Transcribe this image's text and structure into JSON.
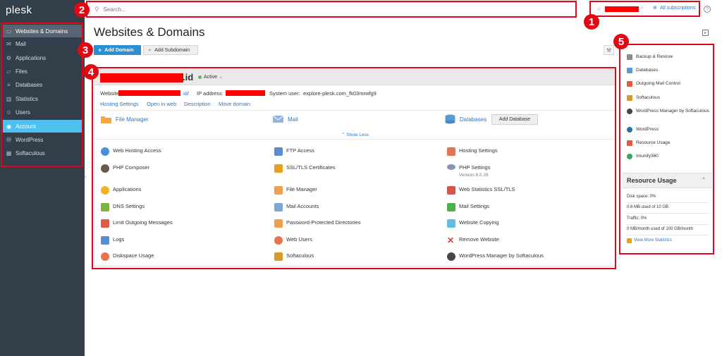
{
  "app": {
    "logo": "plesk"
  },
  "sidebar": {
    "items": [
      {
        "label": "Websites & Domains",
        "icon": "monitor-icon"
      },
      {
        "label": "Mail",
        "icon": "mail-icon"
      },
      {
        "label": "Applications",
        "icon": "gear-icon"
      },
      {
        "label": "Files",
        "icon": "folder-icon"
      },
      {
        "label": "Databases",
        "icon": "database-icon"
      },
      {
        "label": "Statistics",
        "icon": "bar-chart-icon"
      },
      {
        "label": "Users",
        "icon": "user-icon"
      },
      {
        "label": "Account",
        "icon": "account-icon"
      },
      {
        "label": "WordPress",
        "icon": "wordpress-icon"
      },
      {
        "label": "Softaculous",
        "icon": "softaculous-icon"
      }
    ],
    "active_index": 7,
    "highlight_index": 0
  },
  "topbar": {
    "search_placeholder": "Search...",
    "user_menu_caret": "⌄",
    "subscriptions_link": "All subscriptions"
  },
  "annotations": [
    "1",
    "2",
    "3",
    "4",
    "5"
  ],
  "page": {
    "title": "Websites & Domains",
    "add_domain": "Add Domain",
    "add_subdomain": "Add Subdomain"
  },
  "domain": {
    "name_suffix": ".id",
    "status": "Active",
    "website_label": "Website at",
    "website_suffix": ".id/",
    "ip_label": "IP address:",
    "system_user_label": "System user:",
    "system_user": "explore-plesk.com_fk03mrwfg9",
    "links": [
      "Hosting Settings",
      "Open in web",
      "Description",
      "Move domain"
    ],
    "quick": [
      {
        "label": "File Manager",
        "icon": "folder-icon"
      },
      {
        "label": "Mail",
        "icon": "mail-icon"
      },
      {
        "label": "Databases",
        "icon": "database-icon"
      }
    ],
    "add_database": "Add Database",
    "show_less": "⌃ Show Less",
    "tools": [
      {
        "label": "Web Hosting Access",
        "icon": "globe-icon",
        "color": "#4a90d9"
      },
      {
        "label": "FTP Access",
        "icon": "ftp-icon",
        "color": "#5b8bd0"
      },
      {
        "label": "Hosting Settings",
        "icon": "hosting-settings-icon",
        "color": "#e8744f"
      },
      {
        "label": "PHP Composer",
        "icon": "php-composer-icon",
        "color": "#6b5a4a"
      },
      {
        "label": "SSL/TLS Certificates",
        "icon": "lock-icon",
        "color": "#e5a21c"
      },
      {
        "label": "PHP Settings",
        "icon": "php-icon",
        "color": "#8892bf",
        "sub": "Version 8.0.28"
      },
      {
        "label": "Applications",
        "icon": "applications-icon",
        "color": "#f0b323"
      },
      {
        "label": "File Manager",
        "icon": "folder-icon",
        "color": "#f0a04b"
      },
      {
        "label": "Web Statistics SSL/TLS",
        "icon": "web-stats-icon",
        "color": "#d9534f"
      },
      {
        "label": "DNS Settings",
        "icon": "dns-icon",
        "color": "#7cb342"
      },
      {
        "label": "Mail Accounts",
        "icon": "mail-icon",
        "color": "#7fa7d6"
      },
      {
        "label": "Mail Settings",
        "icon": "mail-settings-icon",
        "color": "#4caf50"
      },
      {
        "label": "Limit Outgoing Messages",
        "icon": "limit-mail-icon",
        "color": "#e05a47"
      },
      {
        "label": "Password-Protected Directories",
        "icon": "protected-folder-icon",
        "color": "#f0a04b"
      },
      {
        "label": "Website Copying",
        "icon": "copy-icon",
        "color": "#5bc0de"
      },
      {
        "label": "Logs",
        "icon": "logs-icon",
        "color": "#5b8bd0"
      },
      {
        "label": "Web Users",
        "icon": "web-users-icon",
        "color": "#e8744f"
      },
      {
        "label": "Remove Website",
        "icon": "remove-icon",
        "color": "#e53935"
      },
      {
        "label": "Diskspace Usage",
        "icon": "pie-icon",
        "color": "#e8744f"
      },
      {
        "label": "Softaculous",
        "icon": "softaculous-icon",
        "color": "#d99a2b"
      },
      {
        "label": "WordPress Manager by Softaculous",
        "icon": "wordpress-icon",
        "color": "#464646"
      }
    ]
  },
  "right": {
    "items": [
      {
        "label": "Backup & Restore",
        "icon": "backup-icon",
        "color": "#8a8a8a"
      },
      {
        "label": "Databases",
        "icon": "database-icon",
        "color": "#5b9bd5"
      },
      {
        "label": "Outgoing Mail Control",
        "icon": "mail-control-icon",
        "color": "#e05a47"
      },
      {
        "label": "Softaculous",
        "icon": "softaculous-icon",
        "color": "#d99a2b"
      },
      {
        "label": "WordPress Manager by Softaculous",
        "icon": "wordpress-icon",
        "color": "#464646"
      },
      {
        "label": "WordPress",
        "icon": "wordpress-icon",
        "color": "#21759b"
      },
      {
        "label": "Resource Usage",
        "icon": "resource-icon",
        "color": "#e05a47"
      },
      {
        "label": "Imunify360",
        "icon": "imunify-icon",
        "color": "#3aa655"
      }
    ],
    "usage": {
      "title": "Resource Usage",
      "disk_label": "Disk space: 0%",
      "disk_detail": "0.6 MB used of 10 GB",
      "traffic_label": "Traffic: 0%",
      "traffic_detail": "0 MB/month used of 100 GB/month",
      "more_link": "View More Statistics"
    }
  },
  "colors": {
    "sidebar_bg": "#333e4b",
    "accent": "#4fc1f0",
    "primary_button": "#2a8fd3",
    "link": "#2a76c5",
    "annotation_red": "#e30613"
  }
}
